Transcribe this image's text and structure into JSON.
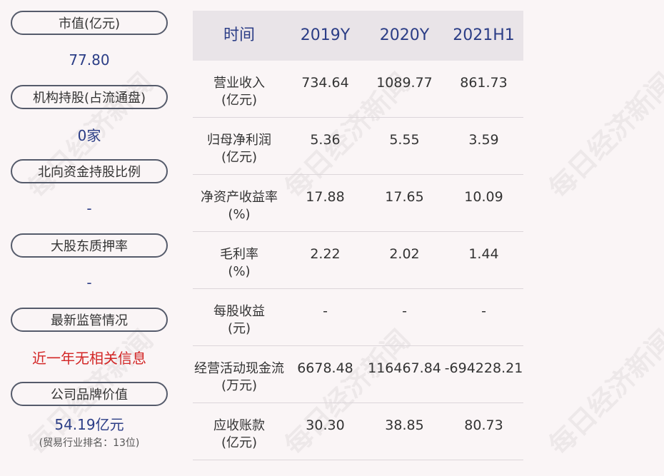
{
  "watermark": "每日经济新闻",
  "left_panel": {
    "items": [
      {
        "label": "市值(亿元)",
        "value": "77.80"
      },
      {
        "label": "机构持股(占流通盘)",
        "value": "0家"
      },
      {
        "label": "北向资金持股比例",
        "value": "-"
      },
      {
        "label": "大股东质押率",
        "value": "-"
      },
      {
        "label": "最新监管情况",
        "value": "近一年无相关信息"
      },
      {
        "label": "公司品牌价值",
        "value": "54.19亿元",
        "sub": "(贸易行业排名：13位)"
      }
    ]
  },
  "table": {
    "headers": [
      "时间",
      "2019Y",
      "2020Y",
      "2021H1"
    ],
    "rows": [
      {
        "label1": "营业收入",
        "label2": "(亿元)",
        "values": [
          "734.64",
          "1089.77",
          "861.73"
        ]
      },
      {
        "label1": "归母净利润",
        "label2": "(亿元)",
        "values": [
          "5.36",
          "5.55",
          "3.59"
        ]
      },
      {
        "label1": "净资产收益率",
        "label2": "(%)",
        "values": [
          "17.88",
          "17.65",
          "10.09"
        ]
      },
      {
        "label1": "毛利率",
        "label2": "(%)",
        "values": [
          "2.22",
          "2.02",
          "1.44"
        ]
      },
      {
        "label1": "每股收益",
        "label2": "(元)",
        "values": [
          "-",
          "-",
          "-"
        ]
      },
      {
        "label1": "经营活动现金流",
        "label2": "(万元)",
        "values": [
          "6678.48",
          "116467.84",
          "-694228.21"
        ]
      },
      {
        "label1": "应收账款",
        "label2": "(亿元)",
        "values": [
          "30.30",
          "38.85",
          "80.73"
        ]
      }
    ]
  },
  "colors": {
    "value_blue": "#2b3d86",
    "alert_red": "#d32626",
    "header_bg": "#e9e4e8"
  }
}
